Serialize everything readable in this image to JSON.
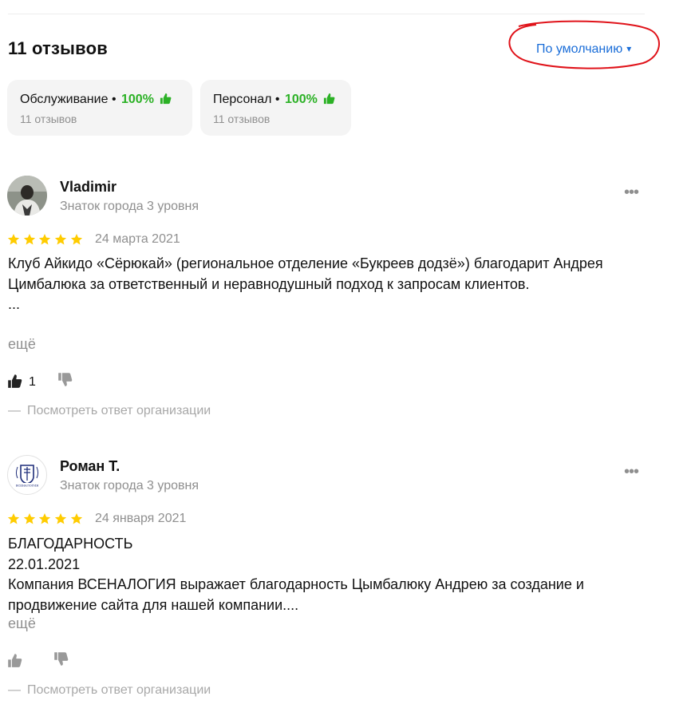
{
  "header": {
    "title": "11 отзывов",
    "sort_label": "По умолчанию",
    "sort_caret": "▾"
  },
  "aspects": [
    {
      "name": "Обслуживание",
      "separator": "•",
      "percent": "100%",
      "count": "11 отзывов"
    },
    {
      "name": "Персонал",
      "separator": "•",
      "percent": "100%",
      "count": "11 отзывов"
    }
  ],
  "reviews": [
    {
      "author": "Vladimir",
      "badge": "Знаток города 3 уровня",
      "rating": 5,
      "date": "24 марта 2021",
      "text": "Клуб Айкидо «Сёрюкай» (региональное отделение «Букреев додзё») благодарит Андрея Цимбалюка за ответственный и неравнодушный подход к запросам клиентов.\n...",
      "expand_label": "ещё",
      "likes": "1",
      "answer_label": "Посмотреть ответ организации",
      "more_label": "•••"
    },
    {
      "author": "Роман Т.",
      "badge": "Знаток города 3 уровня",
      "rating": 5,
      "date": "24 января 2021",
      "text": "БЛАГОДАРНОСТЬ\n22.01.2021\nКомпания ВСЕНАЛОГИЯ выражает благодарность Цымбалюку Андрею за создание и продвижение сайта для нашей компании....",
      "expand_label": "ещё",
      "likes": "",
      "answer_label": "Посмотреть ответ организации",
      "more_label": "•••",
      "avatar_logo_text": "ВСЕНАЛОГИЯ"
    }
  ],
  "colors": {
    "accent": "#1a6dd8",
    "positive": "#2bb125",
    "star": "#fc0",
    "muted": "#8f8f8f",
    "annotation": "#e0131a"
  },
  "icons": {
    "star": "star-icon",
    "thumb_up": "thumb-up-icon",
    "thumb_down": "thumb-down-icon",
    "more": "more-icon"
  }
}
